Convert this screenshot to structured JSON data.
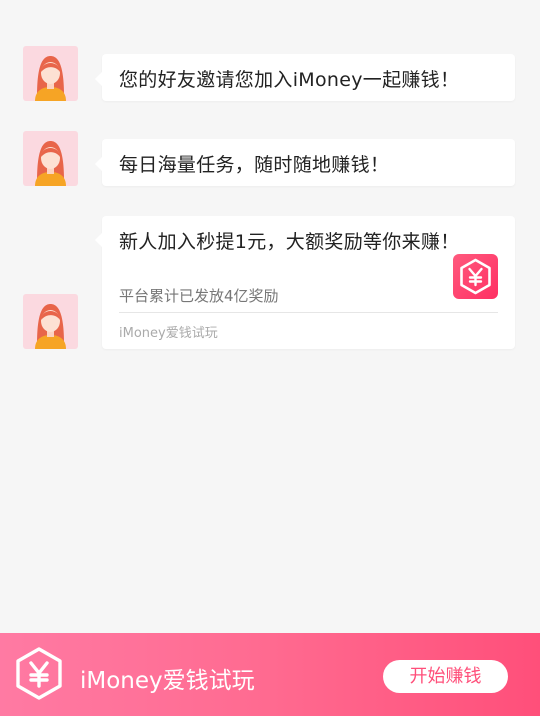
{
  "messages": [
    {
      "text": "您的好友邀请您加入iMoney一起赚钱！"
    },
    {
      "text": "每日海量任务，随时随地赚钱！"
    }
  ],
  "card": {
    "title": "新人加入秒提1元，大额奖励等你来赚！",
    "subtitle": "平台累计已发放4亿奖励",
    "source": "iMoney爱钱试玩",
    "logo_icon": "yen-hexagon-icon"
  },
  "footer": {
    "title": "iMoney爱钱试玩",
    "button_label": "开始赚钱",
    "logo_icon": "yen-hexagon-icon"
  },
  "colors": {
    "accent": "#ff4f7a",
    "background": "#f6f6f6",
    "avatar_bg": "#fbd9e0"
  }
}
